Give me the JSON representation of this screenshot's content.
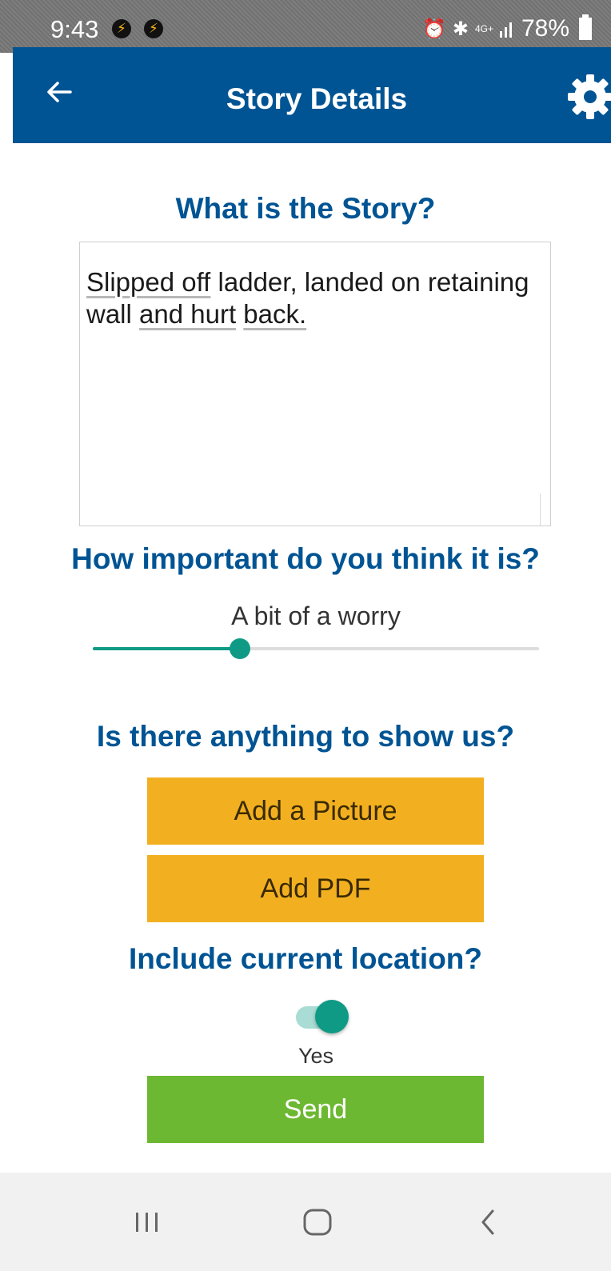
{
  "status_bar": {
    "time": "9:43",
    "network": "4G+",
    "battery": "78%"
  },
  "header": {
    "title": "Story Details",
    "back_icon": "arrow-left-icon",
    "settings_icon": "gear-icon"
  },
  "story": {
    "heading": "What is the Story?",
    "text_parts": [
      "Slipped off",
      " ladder, landed on retaining wall ",
      "and hurt",
      " ",
      "back."
    ]
  },
  "importance": {
    "heading": "How important do you think it is?",
    "value_label": "A bit of a worry",
    "slider_value": 0.33
  },
  "attachments": {
    "heading": "Is there anything to show us?",
    "add_picture_label": "Add a Picture",
    "add_pdf_label": "Add PDF"
  },
  "location": {
    "heading": "Include current location?",
    "toggle_on": true,
    "toggle_label": "Yes"
  },
  "send_label": "Send",
  "colors": {
    "primary": "#005493",
    "accent": "#0f9a85",
    "button_orange": "#f2b021",
    "button_green": "#6db832"
  }
}
